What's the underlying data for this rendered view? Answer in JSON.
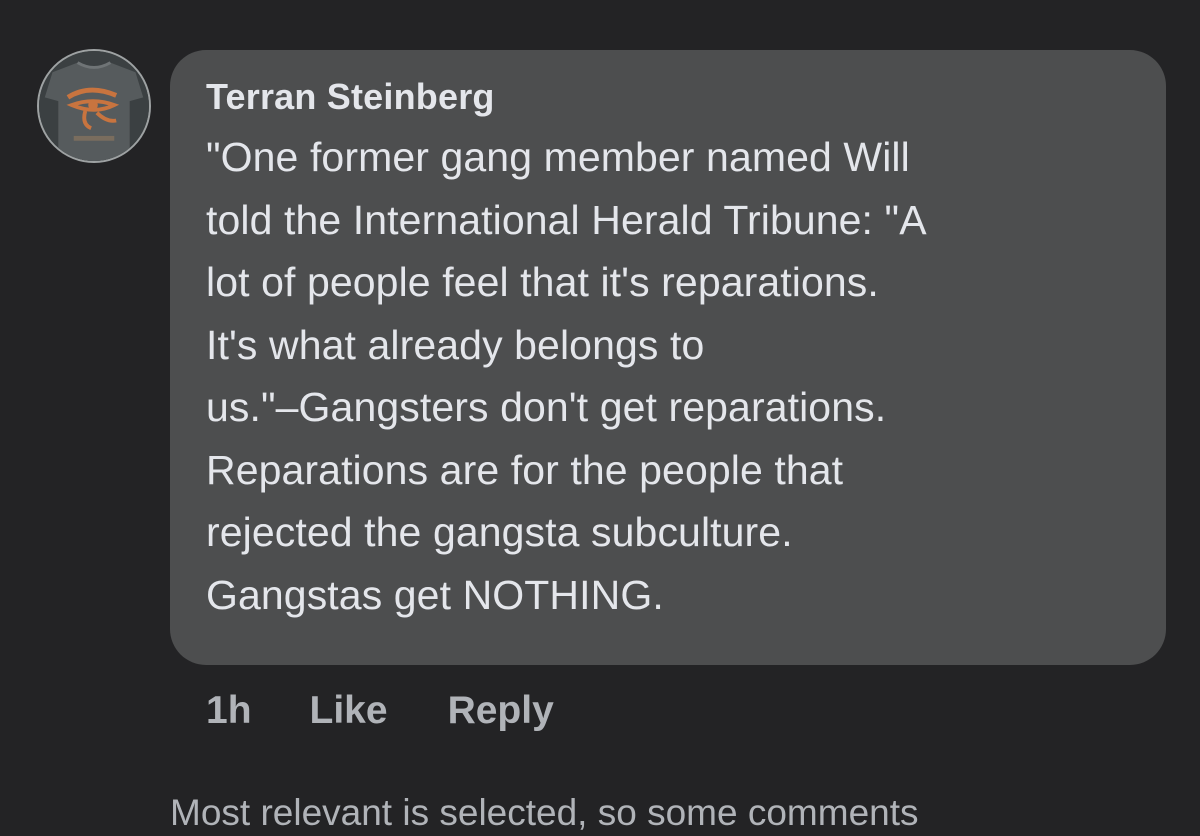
{
  "comment": {
    "author": "Terran Steinberg",
    "avatar_icon": "eye-of-horus-shirt-avatar",
    "lines": [
      "\"One former gang member named Will",
      "told the International Herald Tribune: \"A",
      "lot of people feel that it's reparations.",
      "It's what already belongs to",
      "us.\"–Gangsters don't get reparations.",
      "Reparations are for the people that",
      "rejected the gangsta subculture.",
      "Gangstas get NOTHING."
    ],
    "timestamp": "1h",
    "like_label": "Like",
    "reply_label": "Reply"
  },
  "footer": {
    "note": "Most relevant is selected, so some comments"
  },
  "colors": {
    "background": "#232325",
    "bubble": "#4d4e4f",
    "primary_text": "#e4e6eb",
    "secondary_text": "#b0b3b8"
  }
}
